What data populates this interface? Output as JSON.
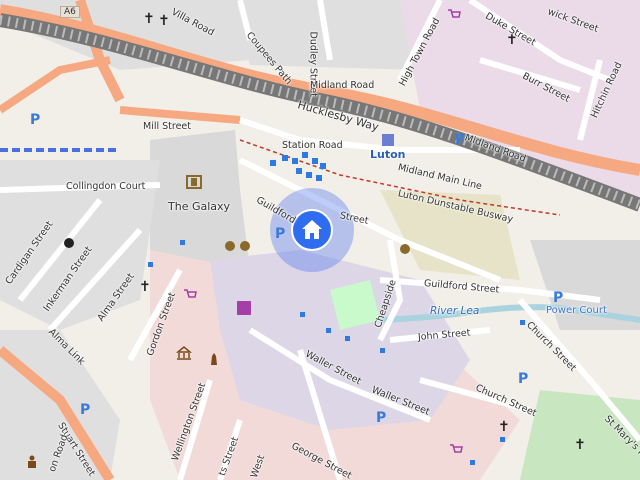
{
  "map": {
    "labels": {
      "a6": "A6",
      "villa_road": "Villa Road",
      "dudley_street": "Dudley Street",
      "coupees_path": "Coupees Path",
      "duke_street": "Duke Street",
      "wick_street": "wick Street",
      "high_town_road": "High Town Road",
      "midland_road_1": "Midland Road",
      "midland_road_2": "Midland Road",
      "burr_street": "Burr Street",
      "hitchin_road": "Hitchin Road",
      "hucklesby_way": "Hucklesby Way",
      "mill_street": "Mill Street",
      "station_road": "Station Road",
      "luton": "Luton",
      "midland_main_line": "Midland Main Line",
      "luton_dunstable_busway": "Luton Dunstable Busway",
      "collingdon_court": "Collingdon Court",
      "the_galaxy": "The Galaxy",
      "guildford_street_1": "Guildford",
      "guildford_street_2": "Street",
      "guildford_street_3": "Guildford Street",
      "cardigan_street": "Cardigan Street",
      "inkerman_street": "Inkerman Street",
      "alma_street": "Alma Street",
      "alma_link": "Alma Link",
      "gordon_street": "Gordon Street",
      "cheapside": "Cheapside",
      "river_lea": "River Lea",
      "power_court": "Power Court",
      "church_street_1": "Church Street",
      "church_street_2": "Church Street",
      "john_street": "John Street",
      "waller_street_1": "Waller Street",
      "waller_street_2": "Waller Street",
      "wellington_street": "Wellington Street",
      "stuart_street": "Stuart Street",
      "george_street": "George Street",
      "st_marys_road": "St Mary's Road",
      "on_road": "on Road",
      "west": "West",
      "ts_street": "ts Street"
    },
    "icons": {
      "location_marker": "home-icon",
      "parking": "parking-icon",
      "church": "church-icon",
      "cinema": "cinema-icon",
      "theatre": "theatre-icon",
      "shop": "shopping-cart-icon"
    },
    "parking_glyph": "P",
    "church_glyph": "✝",
    "colors": {
      "background": "#f2efe9",
      "primary_road": "#f6a880",
      "residential": "#e0dfdf",
      "retail": "#f2dad9",
      "railway": "#999999",
      "water": "#aad3df",
      "park": "#c8facc",
      "location": "#2f6df0"
    }
  }
}
